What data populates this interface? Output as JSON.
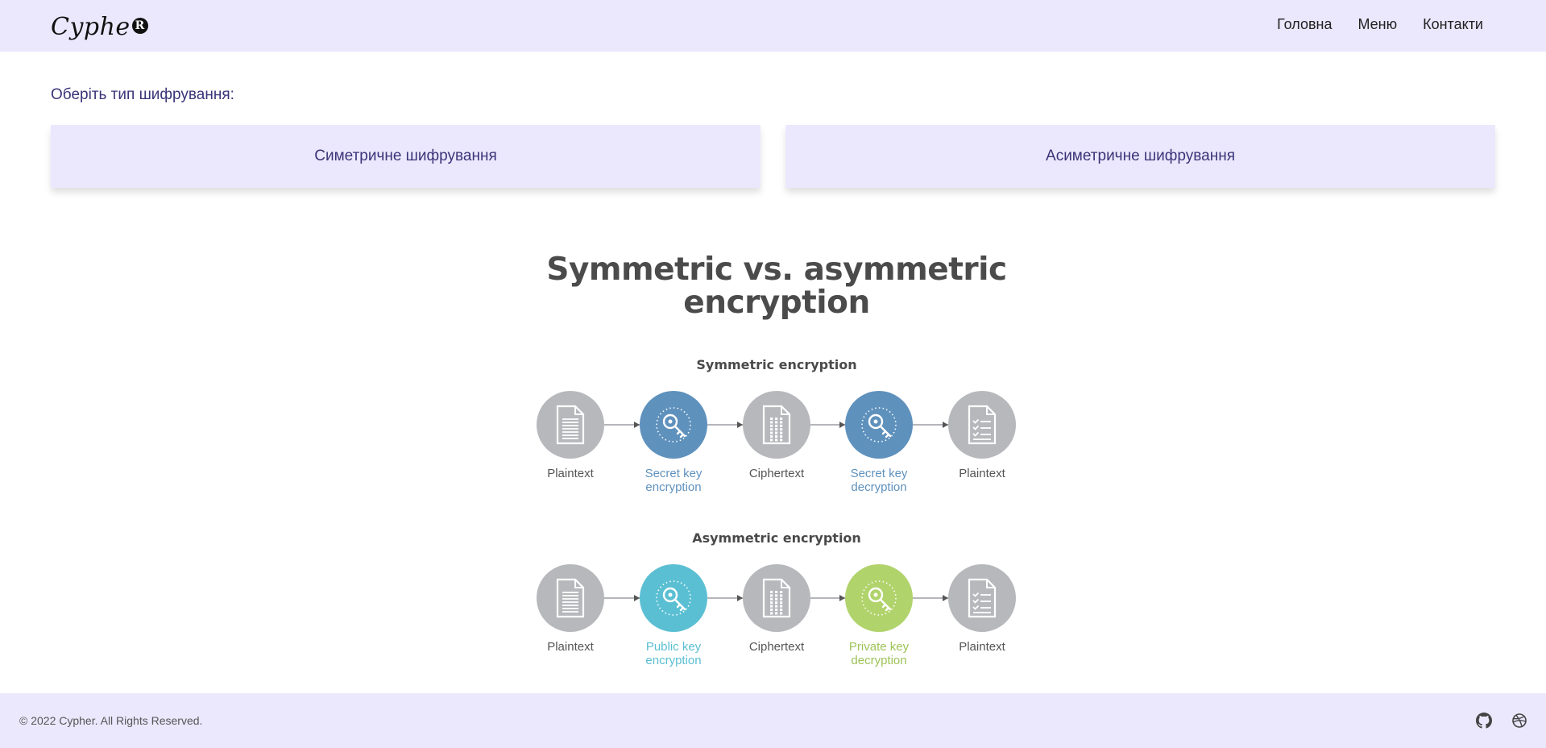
{
  "header": {
    "logo_text": "Cyphe",
    "logo_mark": "R",
    "nav": [
      "Головна",
      "Меню",
      "Контакти"
    ]
  },
  "main": {
    "prompt": "Оберіть тип шифрування:",
    "choices": [
      "Симетричне шифрування",
      "Асиметричне шифрування"
    ]
  },
  "diagram": {
    "title_line1": "Symmetric vs. asymmetric",
    "title_line2": "encryption",
    "symmetric": {
      "title": "Symmetric encryption",
      "steps": [
        {
          "label1": "Plaintext",
          "label2": "",
          "color": "#b7b8bc",
          "icon": "document-icon"
        },
        {
          "label1": "Secret key",
          "label2": "encryption",
          "color": "#5f91bd",
          "icon": "key-icon"
        },
        {
          "label1": "Ciphertext",
          "label2": "",
          "color": "#b7b8bc",
          "icon": "cipher-document-icon"
        },
        {
          "label1": "Secret key",
          "label2": "decryption",
          "color": "#5f91bd",
          "icon": "key-icon"
        },
        {
          "label1": "Plaintext",
          "label2": "",
          "color": "#b7b8bc",
          "icon": "checklist-document-icon"
        }
      ]
    },
    "asymmetric": {
      "title": "Asymmetric encryption",
      "steps": [
        {
          "label1": "Plaintext",
          "label2": "",
          "color": "#b7b8bc",
          "icon": "document-icon"
        },
        {
          "label1": "Public key",
          "label2": "encryption",
          "color": "#5bbfd3",
          "icon": "key-icon"
        },
        {
          "label1": "Ciphertext",
          "label2": "",
          "color": "#b7b8bc",
          "icon": "cipher-document-icon"
        },
        {
          "label1": "Private key",
          "label2": "decryption",
          "color": "#b1d36c",
          "icon": "key-icon"
        },
        {
          "label1": "Plaintext",
          "label2": "",
          "color": "#b7b8bc",
          "icon": "checklist-document-icon"
        }
      ]
    }
  },
  "footer": {
    "copyright": "© 2022 Cypher. All Rights Reserved.",
    "icons": [
      "github-icon",
      "dribbble-icon"
    ]
  },
  "colors": {
    "header_bg": "#ebe8fd",
    "accent_text": "#3a3478",
    "symmetric_key": "#5f91bd",
    "public_key": "#5bbfd3",
    "private_key": "#b1d36c",
    "neutral_node": "#b7b8bc"
  }
}
